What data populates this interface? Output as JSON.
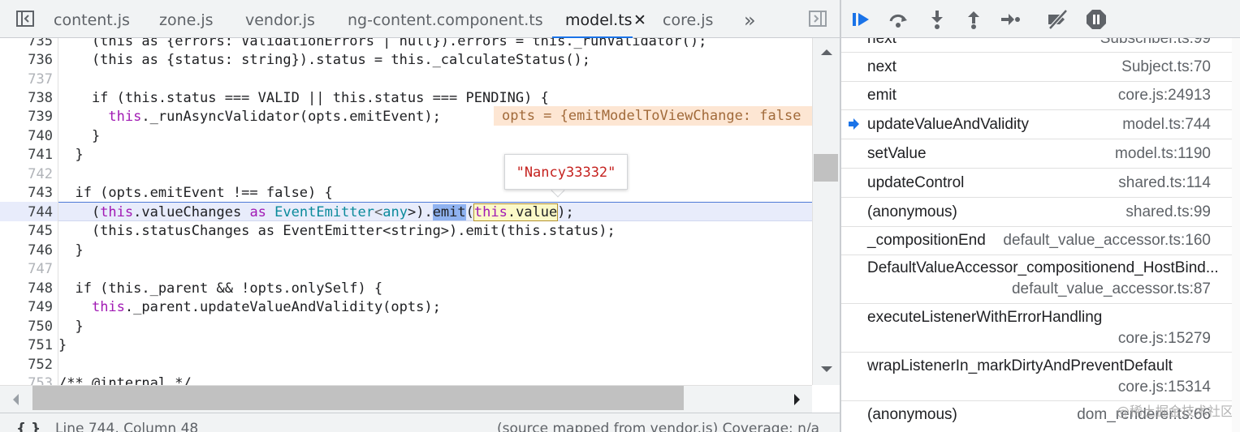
{
  "tabs": {
    "items": [
      "content.js",
      "zone.js",
      "vendor.js",
      "ng-content.component.ts",
      "model.ts",
      "core.js"
    ],
    "active_index": 4,
    "close_glyph": "✕",
    "overflow_glyph": "»"
  },
  "gutter": {
    "line_numbers": [
      "735",
      "736",
      "737",
      "738",
      "739",
      "740",
      "741",
      "742",
      "743",
      "744",
      "745",
      "746",
      "747",
      "748",
      "749",
      "750",
      "751",
      "752",
      "753"
    ]
  },
  "code": {
    "line_735": "    (this as {errors: ValidationErrors | null}).errors = this._runValidator();",
    "line_736": "    (this as {status: string}).status = this._calculateStatus();",
    "line_738": "    if (this.status === VALID || this.status === PENDING) {",
    "line_739_a": "this",
    "line_739_b": "._runAsyncValidator(opts.emitEvent);",
    "line_740": "    }",
    "line_741": "  }",
    "line_743": "  if (opts.emitEvent !== false) {",
    "line_744_a": "this",
    "line_744_b": ".valueChanges ",
    "line_744_c": "as",
    "line_744_d": "EventEmitter",
    "line_744_e": "<",
    "line_744_f": "any",
    "line_744_g": ">).",
    "line_744_h": "emit",
    "line_744_i": "(",
    "line_744_j": "this",
    "line_744_k": ".value",
    "line_744_l": ");",
    "line_745": "    (this.statusChanges as EventEmitter<string>).emit(this.status);",
    "line_746": "  }",
    "line_748": "  if (this._parent && !opts.onlySelf) {",
    "line_749_a": "this",
    "line_749_b": "._parent.updateValueAndValidity(opts);",
    "line_750": "  }",
    "line_751": "}",
    "line_753": "/** @internal */",
    "inline_value": "opts = {emitModelToViewChange: false",
    "popover_value": "\"Nancy33332\""
  },
  "status_bar": {
    "braces": "{ }",
    "position": "Line 744, Column 48",
    "source_map": "(source mapped from vendor.js)  Coverage: n/a"
  },
  "call_stack": {
    "frames": [
      {
        "fn": "next",
        "loc": "Subscriber.ts:99"
      },
      {
        "fn": "next",
        "loc": "Subject.ts:70"
      },
      {
        "fn": "emit",
        "loc": "core.js:24913"
      },
      {
        "fn": "updateValueAndValidity",
        "loc": "model.ts:744",
        "current": true
      },
      {
        "fn": "setValue",
        "loc": "model.ts:1190"
      },
      {
        "fn": "updateControl",
        "loc": "shared.ts:114"
      },
      {
        "fn": "(anonymous)",
        "loc": "shared.ts:99"
      },
      {
        "fn": "_compositionEnd",
        "loc": "default_value_accessor.ts:160"
      },
      {
        "fn": "DefaultValueAccessor_compositionend_HostBind...",
        "loc": "default_value_accessor.ts:87"
      },
      {
        "fn": "executeListenerWithErrorHandling",
        "loc": "core.js:15279"
      },
      {
        "fn": "wrapListenerIn_markDirtyAndPreventDefault",
        "loc": "core.js:15314"
      },
      {
        "fn": "(anonymous)",
        "loc": "dom_renderer.ts:66"
      }
    ]
  },
  "watermark": "@稀土掘金技术社区",
  "colors": {
    "accent": "#1a73e8",
    "keyword": "#a11ab4",
    "type": "#0b8a9b",
    "string_value": "#c5221f",
    "exec_line_bg": "#e8ecfb",
    "inline_value_bg": "#fde6d3"
  },
  "icons": [
    "sidebar-toggle-icon",
    "more-tabs-icon",
    "collapse-panel-icon",
    "resume-icon",
    "step-over-icon",
    "step-into-icon",
    "step-out-icon",
    "step-icon",
    "deactivate-breakpoints-icon",
    "pause-on-exceptions-icon",
    "current-frame-arrow-icon"
  ]
}
